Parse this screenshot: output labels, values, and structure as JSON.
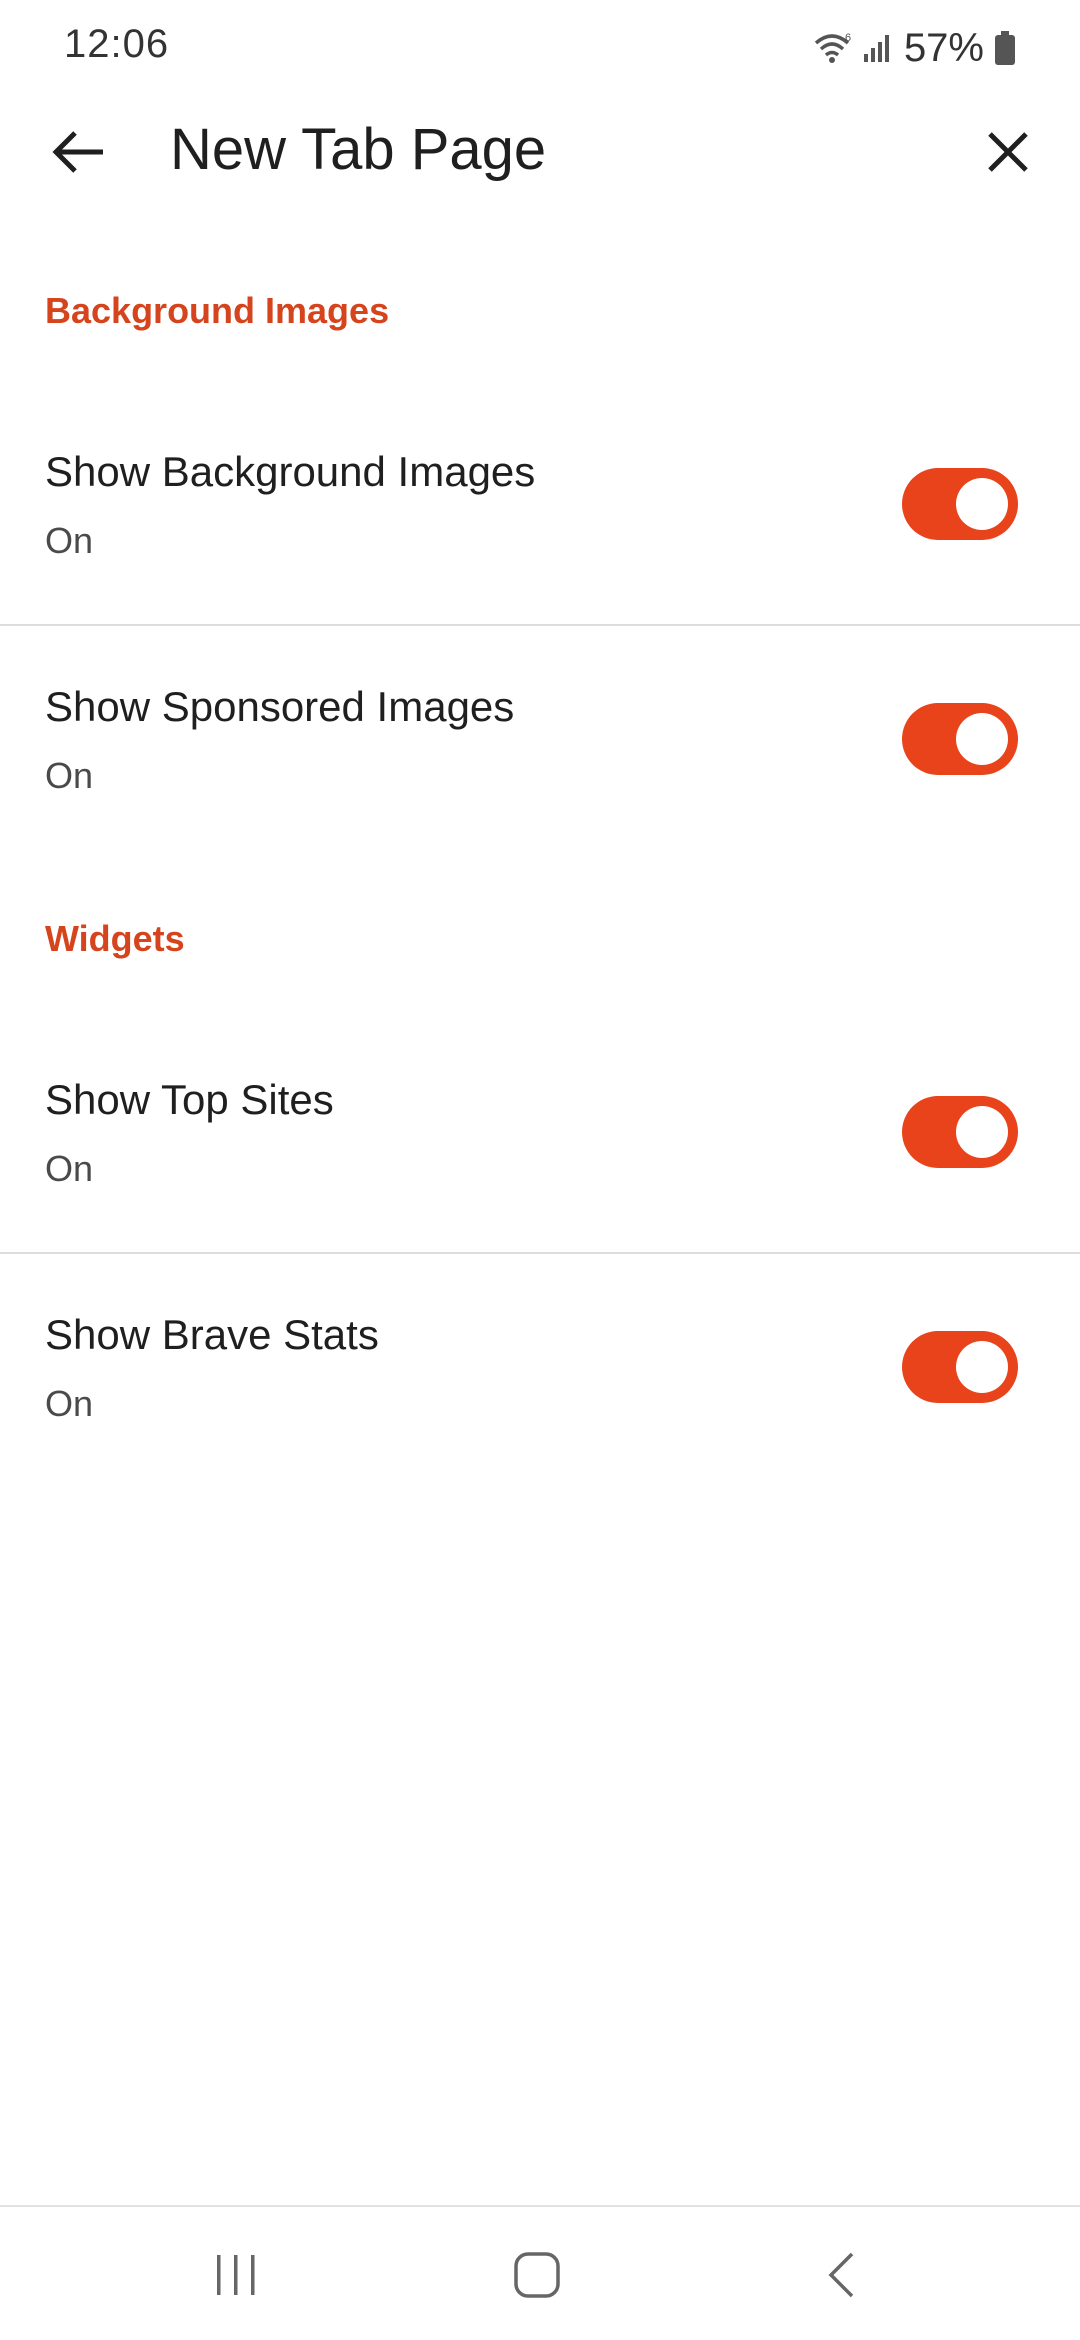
{
  "status_bar": {
    "time": "12:06",
    "battery": "57%",
    "icons": [
      "wifi-icon",
      "signal-icon",
      "battery-icon"
    ]
  },
  "toolbar": {
    "title": "New Tab Page",
    "back_icon": "arrow-left-icon",
    "close_icon": "close-icon"
  },
  "sections": [
    {
      "header": "Background Images",
      "items": [
        {
          "title": "Show Background Images",
          "summary": "On",
          "enabled": true
        },
        {
          "title": "Show Sponsored Images",
          "summary": "On",
          "enabled": true
        }
      ]
    },
    {
      "header": "Widgets",
      "items": [
        {
          "title": "Show Top Sites",
          "summary": "On",
          "enabled": true
        },
        {
          "title": "Show Brave Stats",
          "summary": "On",
          "enabled": true
        }
      ]
    }
  ],
  "nav_bar": {
    "icons": [
      "recent-apps-icon",
      "home-icon",
      "back-icon"
    ]
  },
  "colors": {
    "accent": "#d5441c",
    "toggle_on": "#e8431b",
    "divider": "#dcdcdc"
  }
}
